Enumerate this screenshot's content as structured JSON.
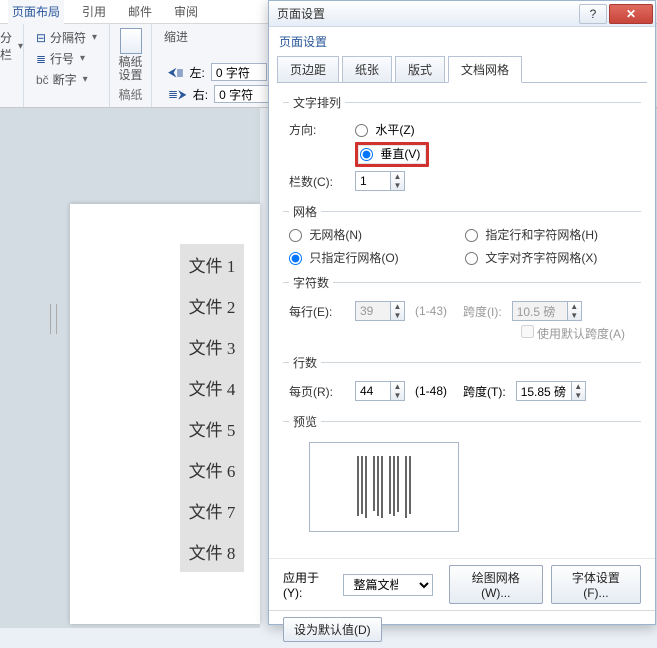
{
  "ribbon": {
    "tabs": [
      "页面布局",
      "引用",
      "邮件",
      "审阅"
    ],
    "active_tab": "页面布局",
    "group_breaks": {
      "item_separator": "分隔符",
      "item_line_no": "行号",
      "item_hyphen": "断字",
      "split_col": "分栏"
    },
    "group_paper": {
      "btn": "稿纸\n设置",
      "cap": "稿纸"
    },
    "group_indent": {
      "title": "缩进",
      "left_lbl": "左:",
      "left_val": "0 字符",
      "right_lbl": "右:",
      "right_val": "0 字符"
    }
  },
  "doc": {
    "files": [
      "文件 1",
      "文件 2",
      "文件 3",
      "文件 4",
      "文件 5",
      "文件 6",
      "文件 7",
      "文件 8"
    ]
  },
  "dialog": {
    "title": "页面设置",
    "tabs": [
      "页边距",
      "纸张",
      "版式",
      "文档网格"
    ],
    "active_tab": "文档网格",
    "sec_text": {
      "legend": "文字排列",
      "dir_label": "方向:",
      "opt_horizontal": "水平(Z)",
      "opt_vertical": "垂直(V)",
      "cols_label": "栏数(C):",
      "cols_val": "1"
    },
    "sec_grid": {
      "legend": "网格",
      "opt_none": "无网格(N)",
      "opt_line_only": "只指定行网格(O)",
      "opt_line_char": "指定行和字符网格(H)",
      "opt_char_align": "文字对齐字符网格(X)"
    },
    "sec_chars": {
      "legend": "字符数",
      "perline_lbl": "每行(E):",
      "perline_val": "39",
      "perline_rng": "(1-43)",
      "pitch_lbl": "跨度(I):",
      "pitch_val": "10.5 磅",
      "use_default": "使用默认跨度(A)"
    },
    "sec_lines": {
      "legend": "行数",
      "perpage_lbl": "每页(R):",
      "perpage_val": "44",
      "perpage_rng": "(1-48)",
      "pitch_lbl": "跨度(T):",
      "pitch_val": "15.85 磅"
    },
    "sec_preview": {
      "legend": "预览"
    },
    "apply_lbl": "应用于(Y):",
    "apply_val": "整篇文档",
    "btn_grid": "绘图网格(W)...",
    "btn_font": "字体设置(F)...",
    "btn_default": "设为默认值(D)"
  }
}
